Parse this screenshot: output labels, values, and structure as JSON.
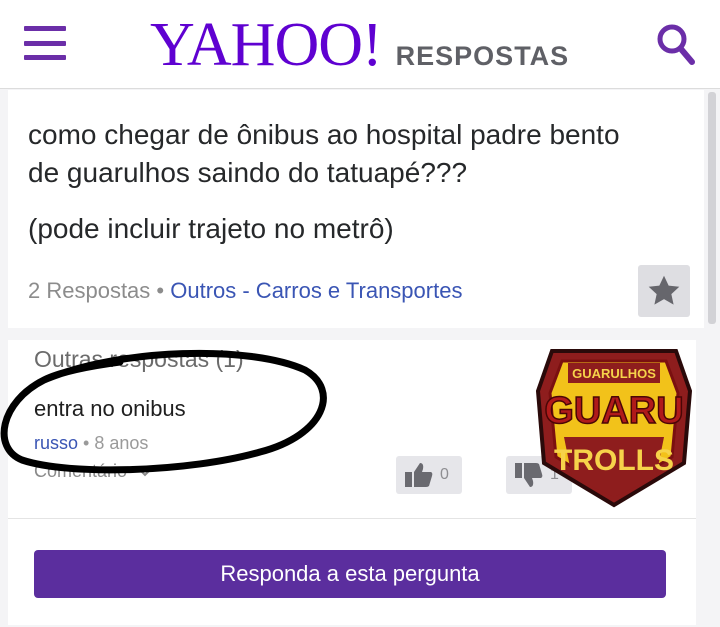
{
  "header": {
    "logo_text": "YAHOO!",
    "section_text": "RESPOSTAS"
  },
  "question": {
    "title": "como chegar de ônibus ao hospital padre bento de guarulhos saindo do tatuapé???",
    "detail": "(pode incluir trajeto no metrô)",
    "answers_count": "2 Respostas",
    "separator": " • ",
    "category": "Outros - Carros e Transportes"
  },
  "answers_section": {
    "header": "Outras respostas (1)",
    "answer": {
      "text": "entra no onibus",
      "user": "russo",
      "separator": " • ",
      "time": "8 anos",
      "comment_label": "Comentário",
      "upvotes": "0",
      "downvotes": "1"
    },
    "answer_button": "Responda a esta pergunta"
  },
  "badge": {
    "line1": "GUARULHOS",
    "line2": "GUARU",
    "line3": "TROLLS"
  },
  "colors": {
    "brand": "#5f01d1",
    "button": "#5b2e9e",
    "link": "#3a55b4"
  }
}
